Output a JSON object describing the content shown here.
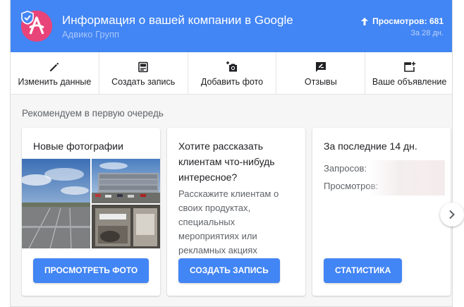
{
  "header": {
    "title": "Информация о вашей компании в Google",
    "subtitle": "Адвико Групп",
    "views_label": "Просмотров: 681",
    "period": "За 28 дн.",
    "accent": "#4285f4",
    "avatar_color": "#e8447a"
  },
  "actions": [
    {
      "label": "Изменить данные",
      "icon": "pencil-icon"
    },
    {
      "label": "Создать запись",
      "icon": "post-icon"
    },
    {
      "label": "Добавить фото",
      "icon": "add-photo-icon"
    },
    {
      "label": "Отзывы",
      "icon": "review-icon"
    },
    {
      "label": "Ваше объявление",
      "icon": "ad-icon"
    }
  ],
  "section_title": "Рекомендуем в первую очередь",
  "cards": [
    {
      "title": "Новые фотографии",
      "button": "Просмотреть фото"
    },
    {
      "title": "Хотите рассказать клиентам что-нибудь интересное?",
      "description": "Расскажите клиентам о своих продуктах, специальных мероприятиях или рекламных акциях",
      "button": "Создать запись"
    },
    {
      "title": "За последние 14 дн.",
      "rows": [
        "Запросов:",
        "Просмотров:"
      ],
      "button": "Статистика"
    }
  ],
  "button_color": "#4285f4"
}
